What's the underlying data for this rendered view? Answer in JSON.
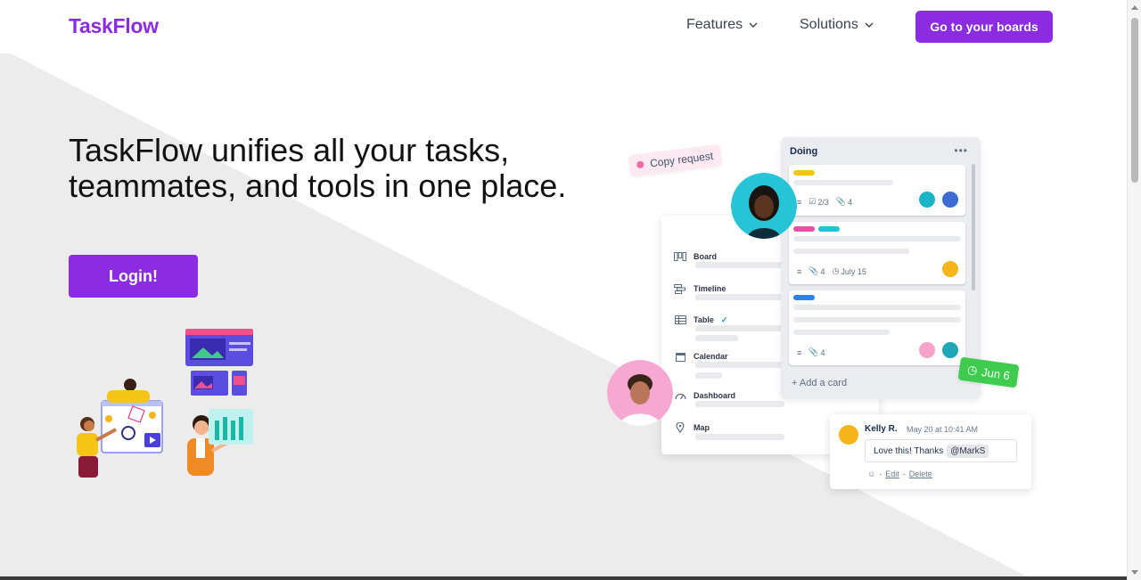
{
  "brand": {
    "name": "TaskFlow",
    "accent": "#8b2be2"
  },
  "nav": {
    "items": [
      {
        "label": "Features",
        "icon": "chevron-down-icon"
      },
      {
        "label": "Solutions",
        "icon": "chevron-down-icon"
      }
    ],
    "cta_label": "Go to your boards"
  },
  "hero": {
    "title": "TaskFlow unifies all your tasks, teammates, and tools in one place.",
    "login_label": "Login!"
  },
  "mockup": {
    "copy_request": "Copy request",
    "views": [
      {
        "label": "Board",
        "icon": "board-icon"
      },
      {
        "label": "Timeline",
        "icon": "timeline-icon"
      },
      {
        "label": "Table",
        "icon": "table-icon"
      },
      {
        "label": "Calendar",
        "icon": "calendar-icon"
      },
      {
        "label": "Dashboard",
        "icon": "dashboard-icon"
      },
      {
        "label": "Map",
        "icon": "map-pin-icon"
      }
    ],
    "list": {
      "title": "Doing",
      "cards": [
        {
          "checklist": "2/3",
          "attachments": "4"
        },
        {
          "attachments": "4",
          "due": "July 15"
        },
        {
          "attachments": "4"
        }
      ],
      "add_card": "Add a card"
    },
    "due_badge": "Jun 6",
    "comment": {
      "author": "Kelly R.",
      "time": "May 20 at 10:41 AM",
      "text": "Love this! Thanks",
      "mention": "@MarkS",
      "edit": "Edit",
      "delete": "Delete",
      "separator": "-"
    }
  }
}
